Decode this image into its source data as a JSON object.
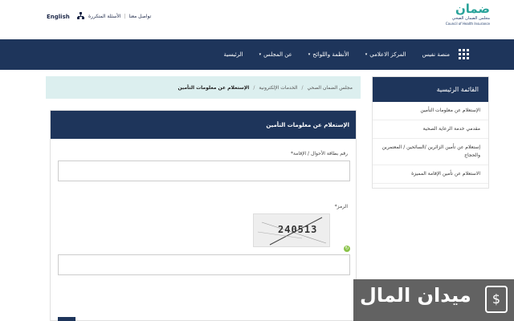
{
  "header": {
    "language_label": "English",
    "links": [
      "تواصل معنا",
      "الأسئلة المتكررة"
    ],
    "logo": {
      "brand": "ضمان",
      "subtitle_ar": "مجلس الضمان الصحي",
      "subtitle_en": "Council of Health Insurance"
    }
  },
  "nav": {
    "items": [
      {
        "label": "الرئيسية",
        "caret": ""
      },
      {
        "label": "عن المجلس",
        "caret": "▾"
      },
      {
        "label": "الأنظمة واللوائح",
        "caret": "▾"
      },
      {
        "label": "المركز الاعلامي",
        "caret": "▾"
      },
      {
        "label": "منصة نفيس",
        "caret": ""
      }
    ]
  },
  "breadcrumb": {
    "items": [
      "مجلس الضمان الصحي",
      "الخدمات الإلكترونية"
    ],
    "current": "الإستعلام عن معلومات التأمين",
    "separator": "/"
  },
  "form": {
    "title": "الإستعلام عن معلومات التأمين",
    "id_label": "رقم بطاقة الأحوال / الإقامة*",
    "code_label": "الرمز*",
    "captcha_text": "240513",
    "id_value": "",
    "code_value": ""
  },
  "side_menu": {
    "title": "القائمة الرئيسية",
    "items": [
      "الإستعلام عن معلومات التأمين",
      "مقدمي خدمة الرعاية الصحية",
      "إستعلام عن تأمين الزائرين /السائحين / المعتمرين والحجاج",
      "الاستعلام عن تأمين الإقامة المميزة"
    ]
  },
  "watermark": {
    "text": "ميدان المال",
    "icon": "$"
  },
  "colors": {
    "primary": "#1e355b",
    "accent": "#2aa39a",
    "breadcrumb_bg": "#dcefef"
  }
}
